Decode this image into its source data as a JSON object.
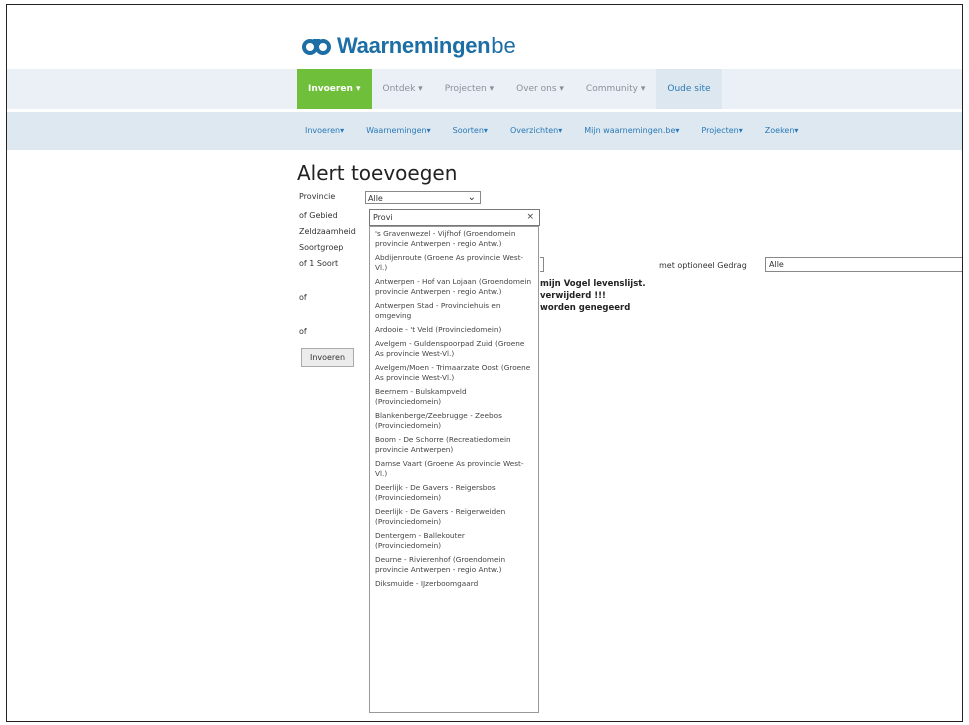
{
  "logo": {
    "name": "Waarnemingen",
    "tld": "be",
    "brand_color": "#1c6ea4"
  },
  "topnav": [
    {
      "label": "Invoeren ▾",
      "active": true
    },
    {
      "label": "Ontdek ▾",
      "active": false
    },
    {
      "label": "Projecten ▾",
      "active": false
    },
    {
      "label": "Over ons ▾",
      "active": false
    },
    {
      "label": "Community ▾",
      "active": false
    },
    {
      "label": "Oude site",
      "active": false
    }
  ],
  "subnav": [
    "Invoeren▾",
    "Waarnemingen▾",
    "Soorten▾",
    "Overzichten▾",
    "Mijn waarnemingen.be▾",
    "Projecten▾",
    "Zoeken▾"
  ],
  "page": {
    "title": "Alert toevoegen",
    "labels": {
      "provincie": "Provincie",
      "gebied": "of Gebied",
      "zeldzaamheid": "Zeldzaamheid",
      "soortgroep": "Soortgroep",
      "soort": "of 1 Soort",
      "of1": "of",
      "of2": "of"
    },
    "provincie_value": "Alle",
    "search_value": "Provi",
    "gedrag_label": "met optioneel Gedrag",
    "gedrag_value": "Alle",
    "bold_lines": [
      "mijn Vogel levenslijst.",
      "verwijderd !!!",
      "worden genegeerd"
    ],
    "submit_label": "Invoeren"
  },
  "dropdown_items": [
    "'s Gravenwezel - Vijfhof (Groendomein provincie Antwerpen - regio Antw.)",
    "Abdijenroute (Groene As provincie West-Vl.)",
    "Antwerpen - Hof van Lojaan (Groendomein provincie Antwerpen - regio Antw.)",
    "Antwerpen Stad - Provinciehuis en omgeving",
    "Ardooie - 't Veld (Provinciedomein)",
    "Avelgem - Guldenspoorpad Zuid (Groene As provincie West-Vl.)",
    "Avelgem/Moen - Trimaarzate Oost (Groene As provincie West-Vl.)",
    "Beernem - Bulskampveld (Provinciedomein)",
    "Blankenberge/Zeebrugge - Zeebos (Provinciedomein)",
    "Boom - De Schorre (Recreatiedomein provincie Antwerpen)",
    "Damse Vaart (Groene As provincie West-Vl.)",
    "Deerlijk - De Gavers - Reigersbos (Provinciedomein)",
    "Deerlijk - De Gavers - Reigerweiden (Provinciedomein)",
    "Dentergem - Ballekouter (Provinciedomein)",
    "Deurne - Rivierenhof (Groendomein provincie Antwerpen - regio Antw.)",
    "Diksmuide - IJzerboomgaard"
  ]
}
